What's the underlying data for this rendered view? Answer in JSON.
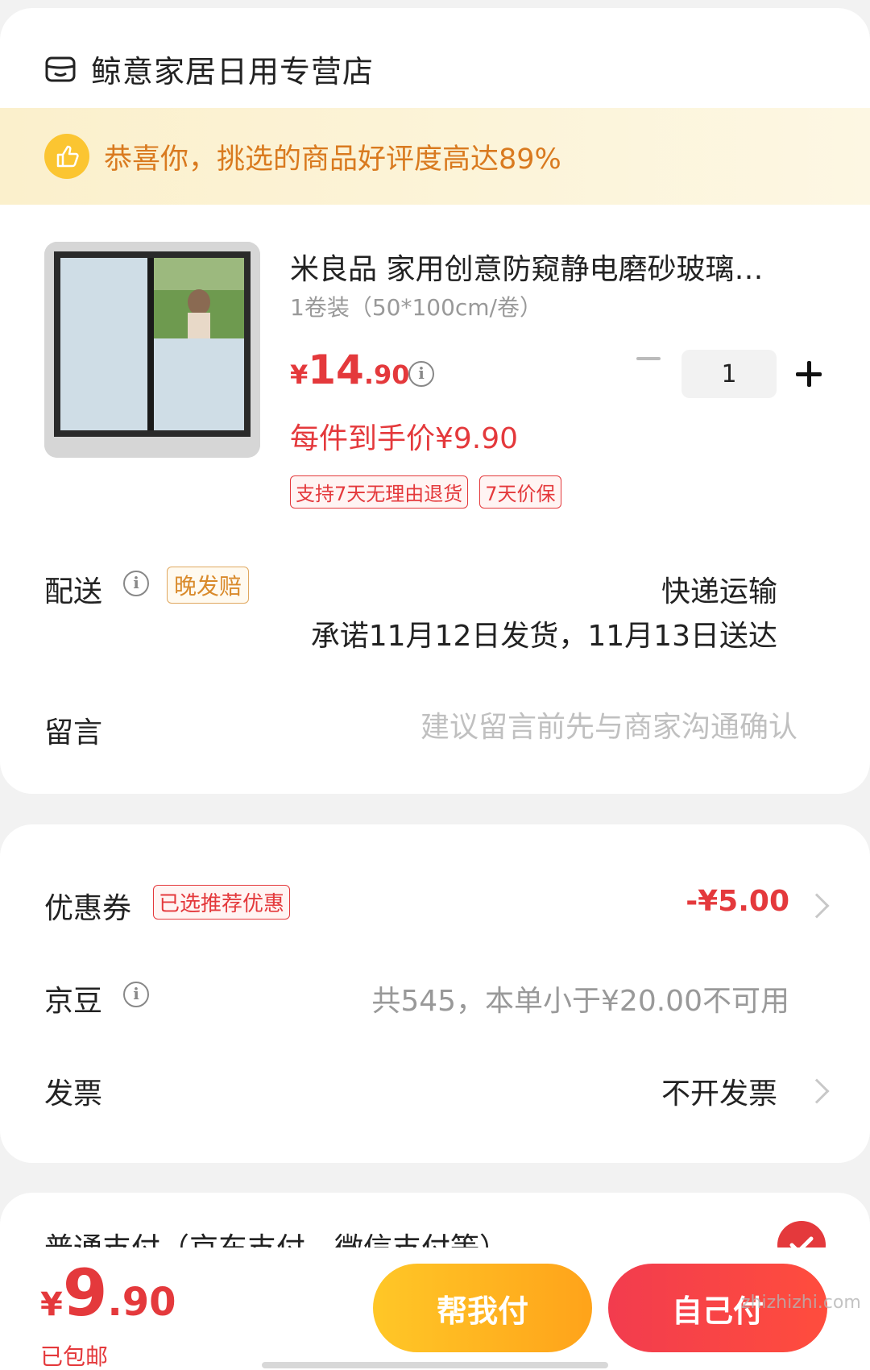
{
  "shop": {
    "name": "鲸意家居日用专营店",
    "icon": "shop-icon"
  },
  "promo": {
    "text": "恭喜你，挑选的商品好评度高达89%",
    "icon": "thumbs-up-icon"
  },
  "product": {
    "title": "米良品 家用创意防窥静电磨砂玻璃…",
    "spec": "1卷装（50*100cm/卷）",
    "price_symbol": "¥",
    "price_integer": "14",
    "price_decimal": ".90",
    "final_price": "每件到手价¥9.90",
    "tags": [
      "支持7天无理由退货",
      "7天价保"
    ],
    "quantity": "1"
  },
  "delivery": {
    "label": "配送",
    "late_tag": "晚发赔",
    "method": "快递运输",
    "date": "承诺11月12日发货，11月13日送达"
  },
  "message": {
    "label": "留言",
    "placeholder": "建议留言前先与商家沟通确认"
  },
  "coupon": {
    "label": "优惠券",
    "tag": "已选推荐优惠",
    "value": "-¥5.00"
  },
  "beans": {
    "label": "京豆",
    "value": "共545，本单小于¥20.00不可用"
  },
  "invoice": {
    "label": "发票",
    "value": "不开发票"
  },
  "payment": {
    "label": "普通支付（京东支付、微信支付等）",
    "selected": true
  },
  "footer": {
    "total_symbol": "¥",
    "total_integer": "9",
    "total_decimal": ".90",
    "shipping": "已包邮",
    "help_pay": "帮我付",
    "self_pay": "自己付",
    "watermark": "zhizhizhi.com"
  },
  "colors": {
    "accent": "#e4393c",
    "promo_text": "#d97a1f",
    "help_btn": "#ffb21f"
  }
}
